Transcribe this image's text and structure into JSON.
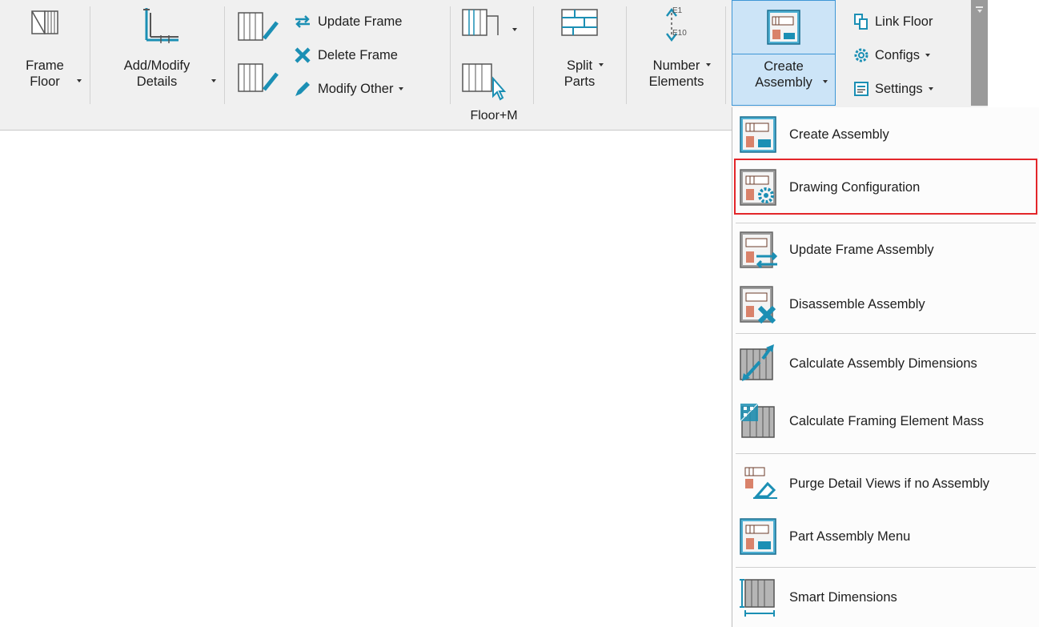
{
  "ribbon": {
    "frame_floor": {
      "line1": "Frame",
      "line2": "Floor"
    },
    "add_modify": {
      "line1": "Add/Modify",
      "line2": "Details"
    },
    "update_frame": "Update Frame",
    "delete_frame": "Delete Frame",
    "modify_other": "Modify Other",
    "split_parts": {
      "line1": "Split",
      "line2": "Parts"
    },
    "number_elements": {
      "line1": "Number",
      "line2": "Elements",
      "tag_top": "E1",
      "tag_bottom": "E10"
    },
    "create_assembly": {
      "line1": "Create",
      "line2": "Assembly"
    },
    "link_floor": "Link Floor",
    "configs": "Configs",
    "settings": "Settings",
    "panel_title": "Floor+M"
  },
  "menu": {
    "items": [
      {
        "label": "Create  Assembly",
        "icon": "create-assembly-icon"
      },
      {
        "label": "Drawing Configuration",
        "icon": "drawing-configuration-icon"
      },
      {
        "label": "Update Frame Assembly",
        "icon": "update-assembly-icon"
      },
      {
        "label": "Disassemble Assembly",
        "icon": "disassemble-assembly-icon"
      },
      {
        "label": "Calculate Assembly Dimensions",
        "icon": "calculate-dimensions-icon"
      },
      {
        "label": "Calculate Framing Element Mass",
        "icon": "calculate-mass-icon"
      },
      {
        "label": "Purge Detail Views if no Assembly",
        "icon": "purge-views-icon"
      },
      {
        "label": "Part Assembly Menu",
        "icon": "part-assembly-icon"
      },
      {
        "label": "Smart Dimensions",
        "icon": "smart-dimensions-icon"
      }
    ],
    "highlighted_index": 1
  },
  "colors": {
    "accent_teal": "#1b8fb4",
    "highlight_border": "#e3262a",
    "selected_button_bg": "#cce4f7",
    "ribbon_bg": "#f0f0f0"
  }
}
